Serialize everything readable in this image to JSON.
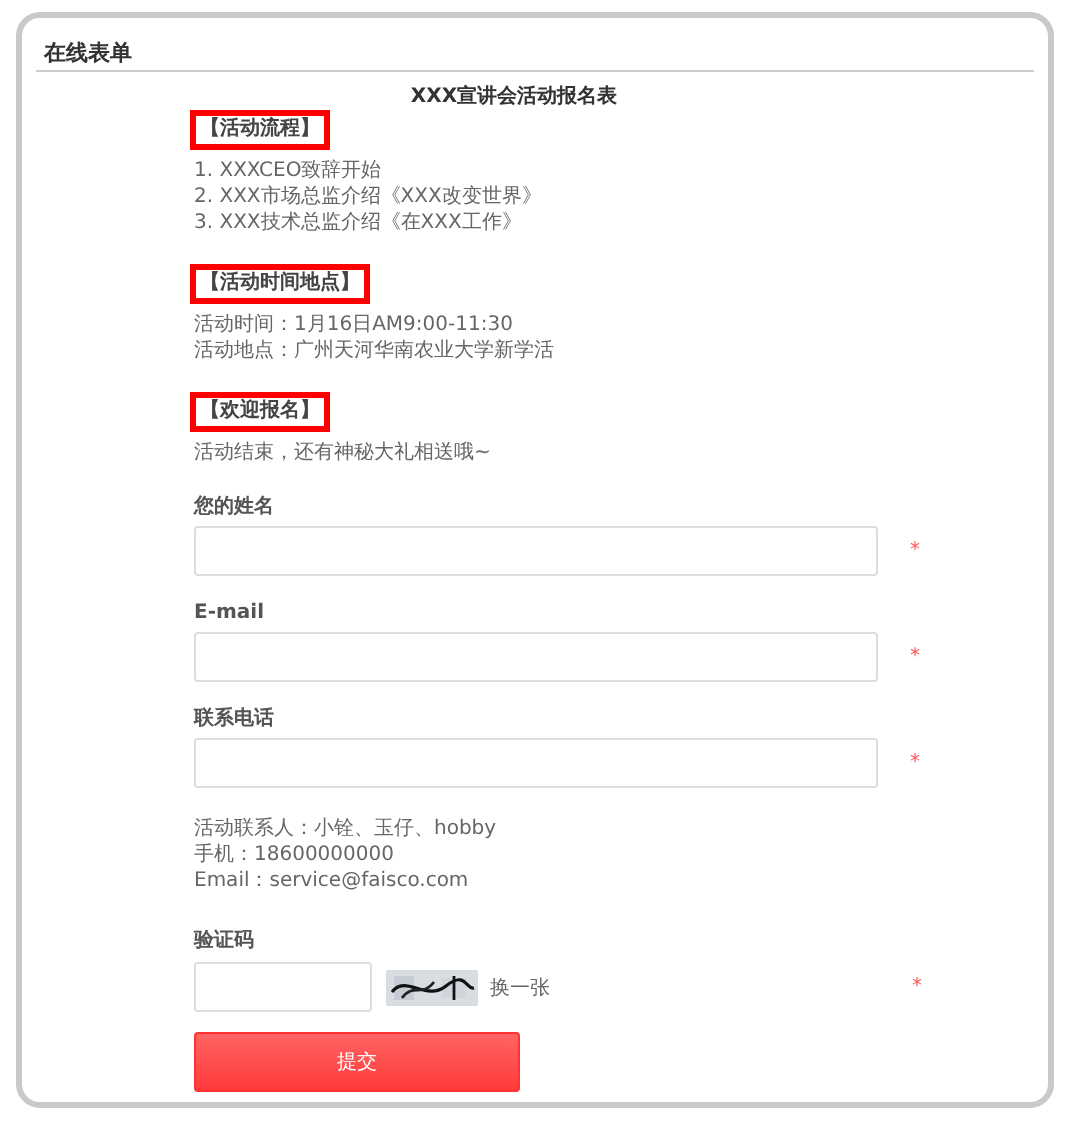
{
  "panel_title": "在线表单",
  "form_title": "XXX宣讲会活动报名表",
  "sections": [
    {
      "heading": "【活动流程】",
      "lines": [
        "1. XXXCEO致辞开始",
        "2. XXX市场总监介绍《XXX改变世界》",
        "3. XXX技术总监介绍《在XXX工作》"
      ]
    },
    {
      "heading": "【活动时间地点】",
      "lines": [
        "活动时间：1月16日AM9:00-11:30",
        "活动地点：广州天河华南农业大学新学活"
      ]
    },
    {
      "heading": "【欢迎报名】",
      "lines": [
        "活动结束，还有神秘大礼相送哦~"
      ]
    }
  ],
  "fields": [
    {
      "label": "您的姓名",
      "required": true
    },
    {
      "label": "E-mail",
      "required": true
    },
    {
      "label": "联系电话",
      "required": true
    }
  ],
  "contact_lines": [
    "活动联系人：小铨、玉仔、hobby",
    "手机：18600000000",
    "Email：service@faisco.com"
  ],
  "captcha": {
    "label": "验证码",
    "refresh_link": "换一张",
    "required": true
  },
  "required_mark": "*",
  "submit_button": "提交"
}
